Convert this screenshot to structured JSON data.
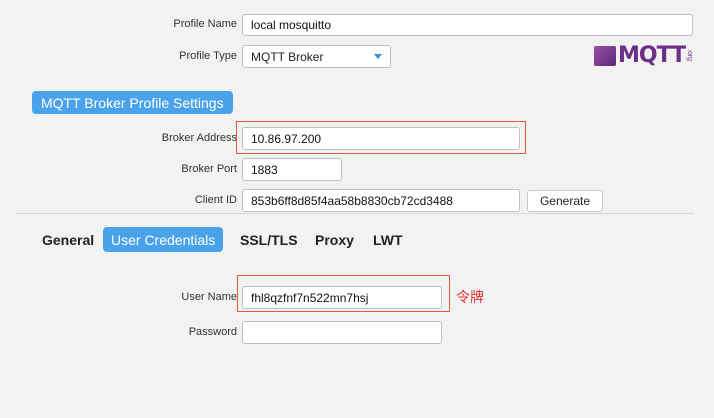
{
  "profile": {
    "name_label": "Profile Name",
    "name_value": "local mosquitto",
    "type_label": "Profile Type",
    "type_value": "MQTT Broker"
  },
  "logo": {
    "text": "MQTT",
    "suffix": ".org"
  },
  "broker_section": {
    "title": "MQTT Broker Profile Settings",
    "address_label": "Broker Address",
    "address_value": "10.86.97.200",
    "port_label": "Broker Port",
    "port_value": "1883",
    "client_id_label": "Client ID",
    "client_id_value": "853b6ff8d85f4aa58b8830cb72cd3488",
    "generate_label": "Generate"
  },
  "tabs": [
    {
      "label": "General",
      "active": false
    },
    {
      "label": "User Credentials",
      "active": true
    },
    {
      "label": "SSL/TLS",
      "active": false
    },
    {
      "label": "Proxy",
      "active": false
    },
    {
      "label": "LWT",
      "active": false
    }
  ],
  "credentials": {
    "username_label": "User Name",
    "username_value": "fhl8qzfnf7n522mn7hsj",
    "password_label": "Password",
    "password_value": "",
    "annotation": "令牌"
  },
  "colors": {
    "accent": "#4aa3ea",
    "highlight": "#e05a3a",
    "annotation": "#dd3333"
  }
}
